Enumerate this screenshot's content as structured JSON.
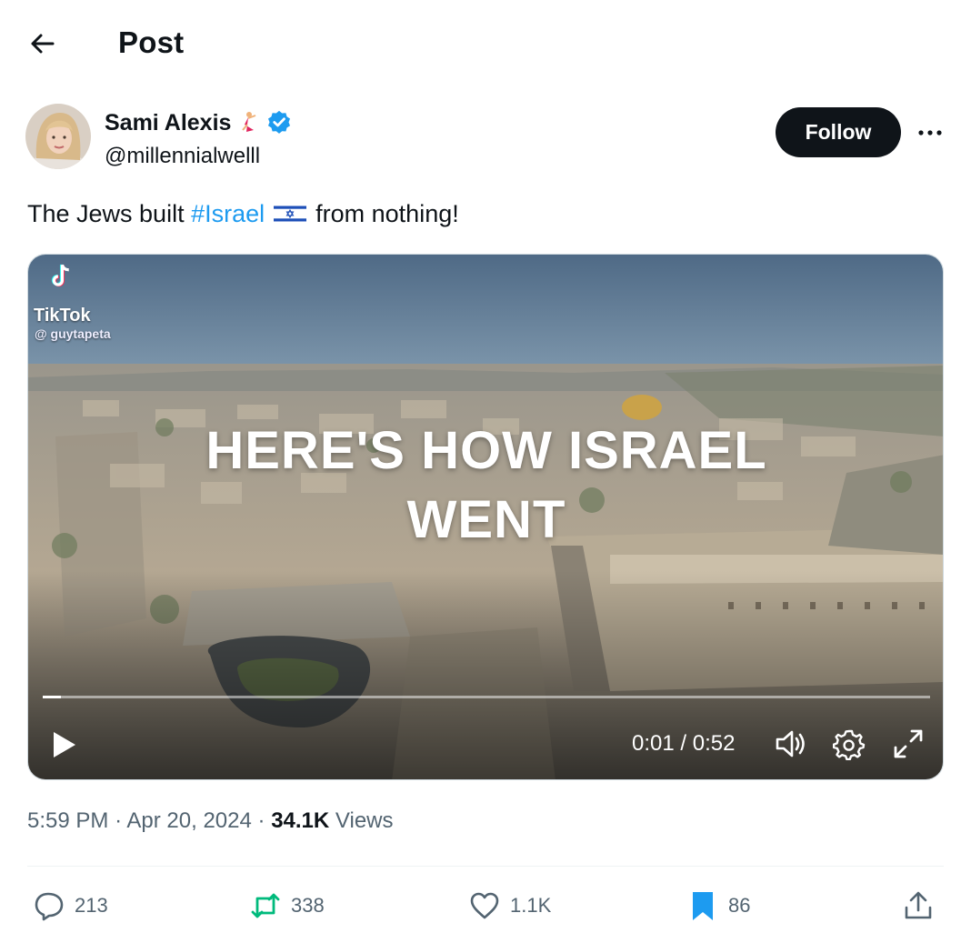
{
  "header": {
    "title": "Post"
  },
  "author": {
    "display_name": "Sami Alexis",
    "handle": "@millennialwelll",
    "follow_label": "Follow"
  },
  "tweet": {
    "text_before": "The Jews built",
    "hashtag": "#Israel",
    "text_after": "from nothing!"
  },
  "video": {
    "tiktok_label": "TikTok",
    "tiktok_user": "@ guytapeta",
    "caption_line1": "HERE'S HOW ISRAEL",
    "caption_line2": "WENT",
    "current_time": "0:01",
    "separator": "/",
    "duration": "0:52",
    "progress_fraction": 0.02
  },
  "meta": {
    "time": "5:59 PM",
    "dot": "·",
    "date": "Apr 20, 2024",
    "views_count": "34.1K",
    "views_label": "Views"
  },
  "actions": {
    "replies": "213",
    "reposts": "338",
    "likes": "1.1K",
    "bookmarks": "86"
  },
  "colors": {
    "accent": "#1d9bf0",
    "repost_green": "#00ba7c",
    "bookmark_blue": "#1d9bf0",
    "text": "#0f1419",
    "secondary": "#536471"
  }
}
